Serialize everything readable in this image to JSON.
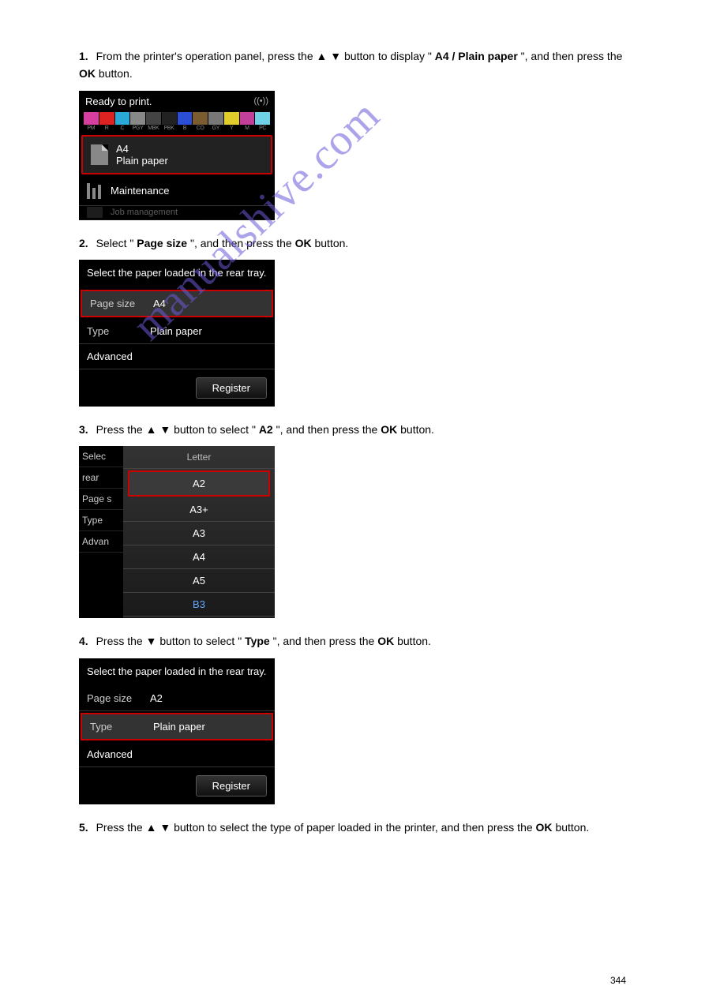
{
  "step1": {
    "num": "1.",
    "text_before": "From the printer's operation panel, press the ",
    "text_mid": " button to display \"",
    "menu_item": "A4 / Plain paper",
    "text_after": "\", and then press the "
  },
  "ok_button": "OK",
  "screen1": {
    "title": "Ready to print.",
    "inks": [
      {
        "lbl": "PM",
        "color": "#d63fa0"
      },
      {
        "lbl": "R",
        "color": "#d22"
      },
      {
        "lbl": "C",
        "color": "#2aa8d6"
      },
      {
        "lbl": "PGY",
        "color": "#888"
      },
      {
        "lbl": "MBK",
        "color": "#444"
      },
      {
        "lbl": "PBK",
        "color": "#222"
      },
      {
        "lbl": "B",
        "color": "#2a4ed6"
      },
      {
        "lbl": "CO",
        "color": "#7a5c2e"
      },
      {
        "lbl": "GY",
        "color": "#777"
      },
      {
        "lbl": "Y",
        "color": "#e0cc2a"
      },
      {
        "lbl": "M",
        "color": "#c23f9a"
      },
      {
        "lbl": "PC",
        "color": "#6fd0e6"
      }
    ],
    "paper_size": "A4",
    "paper_type": "Plain paper",
    "maintenance": "Maintenance",
    "job_mgmt": "Job management"
  },
  "step2": {
    "num": "2.",
    "text_before": "Select \"",
    "item": "Page size",
    "text_after": "\", and then press the "
  },
  "screen2": {
    "prompt": "Select the paper loaded in the rear tray.",
    "page_size_label": "Page size",
    "page_size_value": "A4",
    "type_label": "Type",
    "type_value": "Plain paper",
    "advanced": "Advanced",
    "register": "Register"
  },
  "step3": {
    "num": "3.",
    "text_before": "Press the ",
    "text_mid": " button to select \"",
    "item": "A2",
    "text_after": "\", and then press the "
  },
  "screen3": {
    "bg_labels": [
      "Selec",
      "rear",
      "Page s",
      "Type",
      "Advan"
    ],
    "items": [
      "Letter",
      "A2",
      "A3+",
      "A3",
      "A4",
      "A5",
      "B3"
    ],
    "selected_index": 1
  },
  "step4": {
    "num": "4.",
    "text_before": "Press the ",
    "text_mid": " button to select \"",
    "item": "Type",
    "text_after": "\", and then press the "
  },
  "screen4": {
    "prompt": "Select the paper loaded in the rear tray.",
    "page_size_label": "Page size",
    "page_size_value": "A2",
    "type_label": "Type",
    "type_value": "Plain paper",
    "advanced": "Advanced",
    "register": "Register"
  },
  "step5": {
    "num": "5.",
    "text_before": "Press the ",
    "text_mid": " button to select the type of paper loaded in the printer, and then press the "
  },
  "watermark": "manualshive.com",
  "page_number": "344"
}
